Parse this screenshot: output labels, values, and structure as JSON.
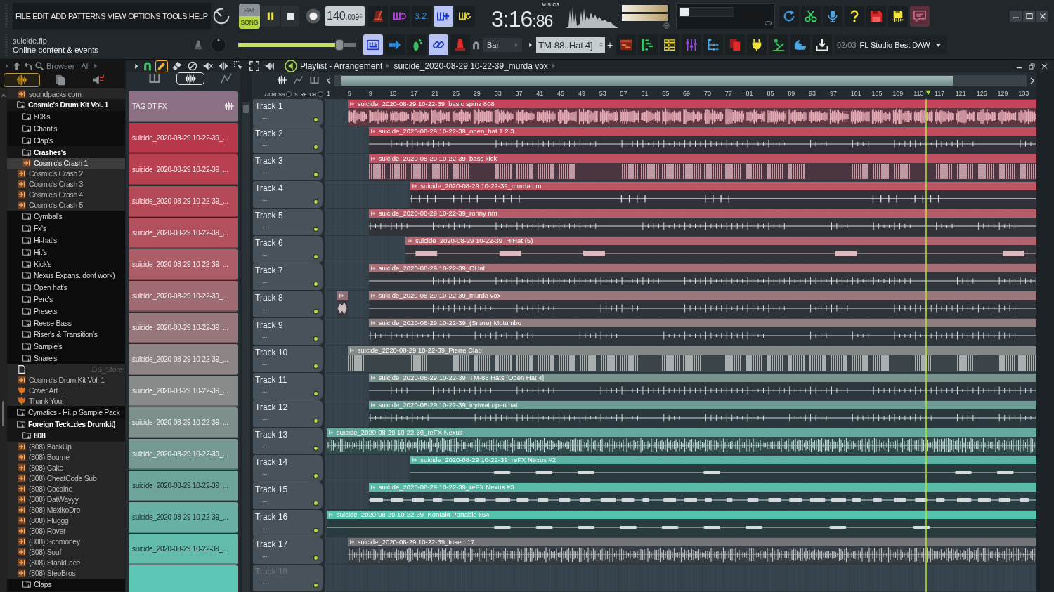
{
  "menu": [
    "FILE",
    "EDIT",
    "ADD",
    "PATTERNS",
    "VIEW",
    "OPTIONS",
    "TOOLS",
    "HELP"
  ],
  "transport": {
    "modes": [
      {
        "label": "PAT",
        "selected": false
      },
      {
        "label": "SONG",
        "selected": true
      }
    ],
    "playing": true,
    "recording": false,
    "tempo": "140",
    "tempo_fraction": ".009"
  },
  "record_options": [
    {
      "on": false
    },
    {
      "on": false
    },
    {
      "label": "3.2.",
      "on": false
    },
    {
      "on": true
    },
    {
      "on": false
    }
  ],
  "clock": {
    "time": "3:16",
    "centiseconds": ":86",
    "format": "M:S:CS"
  },
  "meters": [
    {
      "level": 0.96
    },
    {
      "level": 0.96
    }
  ],
  "performance": {
    "level": 0.16
  },
  "project": {
    "file": "suicide.flp",
    "hint": "Online content & events"
  },
  "master_volume": {
    "level": 0.86
  },
  "playback_options": [
    {
      "on": true
    },
    {
      "on": false
    },
    {
      "on": false
    },
    {
      "on": true
    },
    {
      "on": false
    }
  ],
  "snap": "Bar",
  "pattern": {
    "value": "TM-88..Hat 4]",
    "add": "+"
  },
  "news": {
    "counter": "02/03",
    "title": "FL Studio Best DAW"
  },
  "browser": {
    "title": "Browser - All",
    "tabs": [
      {
        "selected": true
      },
      {
        "selected": false
      },
      {
        "selected": false
      }
    ],
    "items": [
      {
        "kind": "sample",
        "name": "soundpacks.com",
        "selected": false
      },
      {
        "kind": "folder",
        "name": "Cosmic's Drum Kit Vol. 1",
        "expanded": true,
        "selected": false,
        "children": [
          {
            "kind": "folder",
            "name": "808's",
            "expanded": false,
            "selected": false
          },
          {
            "kind": "folder",
            "name": "Chant's",
            "expanded": false,
            "selected": false
          },
          {
            "kind": "folder",
            "name": "Clap's",
            "expanded": false,
            "selected": false
          },
          {
            "kind": "folder",
            "name": "Crashes's",
            "expanded": true,
            "selected": false,
            "children": [
              {
                "kind": "sample",
                "name": "Cosmic's Crash 1",
                "selected": true
              },
              {
                "kind": "sample",
                "name": "Cosmic's Crash 2",
                "selected": false
              },
              {
                "kind": "sample",
                "name": "Cosmic's Crash 3",
                "selected": false
              },
              {
                "kind": "sample",
                "name": "Cosmic's Crash 4",
                "selected": false
              },
              {
                "kind": "sample",
                "name": "Cosmic's Crash 5",
                "selected": false
              }
            ]
          },
          {
            "kind": "folder",
            "name": "Cymbal's",
            "expanded": false,
            "selected": false
          },
          {
            "kind": "folder",
            "name": "Fx's",
            "expanded": false,
            "selected": false
          },
          {
            "kind": "folder",
            "name": "Hi-hat's",
            "expanded": false,
            "selected": false
          },
          {
            "kind": "folder",
            "name": "Hit's",
            "expanded": false,
            "selected": false
          },
          {
            "kind": "folder",
            "name": "Kick's",
            "expanded": false,
            "selected": false
          },
          {
            "kind": "folder",
            "name": "Nexus Expans..dont work)",
            "expanded": false,
            "selected": false
          },
          {
            "kind": "folder",
            "name": "Open hat's",
            "expanded": false,
            "selected": false
          },
          {
            "kind": "folder",
            "name": "Perc's",
            "expanded": false,
            "selected": false
          },
          {
            "kind": "folder",
            "name": "Presets",
            "expanded": false,
            "selected": false
          },
          {
            "kind": "folder",
            "name": "Reese Bass",
            "expanded": false,
            "selected": false
          },
          {
            "kind": "folder",
            "name": "Riser's & Transition's",
            "expanded": false,
            "selected": false
          },
          {
            "kind": "folder",
            "name": "Sample's",
            "expanded": false,
            "selected": false
          },
          {
            "kind": "folder",
            "name": "Snare's",
            "expanded": false,
            "selected": false
          },
          {
            "kind": "document",
            "name": ".DS_Store",
            "selected": false
          },
          {
            "kind": "sample",
            "name": "Cosmic's Drum Kit Vol. 1",
            "selected": false
          },
          {
            "kind": "image",
            "name": "Cover Art",
            "selected": false
          },
          {
            "kind": "image",
            "name": "Thank You!",
            "selected": false
          }
        ]
      },
      {
        "kind": "folder",
        "name": "Cymatics - Hi..p Sample Pack",
        "expanded": false,
        "selected": false
      },
      {
        "kind": "folder",
        "name": "Foreign Teck..des Drumkit)",
        "expanded": true,
        "selected": false,
        "children": [
          {
            "kind": "folder",
            "name": "808",
            "expanded": true,
            "selected": false,
            "children": [
              {
                "kind": "sample",
                "name": "(808) BackUp",
                "selected": false
              },
              {
                "kind": "sample",
                "name": "(808) Bourne",
                "selected": false
              },
              {
                "kind": "sample",
                "name": "(808) Cake",
                "selected": false
              },
              {
                "kind": "sample",
                "name": "(808) CheatCode Sub",
                "selected": false
              },
              {
                "kind": "sample",
                "name": "(808) Cocaine",
                "selected": false
              },
              {
                "kind": "sample",
                "name": "(808) DatWayyy",
                "selected": false
              },
              {
                "kind": "sample",
                "name": "(808) MexikoDro",
                "selected": false
              },
              {
                "kind": "sample",
                "name": "(808) Pluggg",
                "selected": false
              },
              {
                "kind": "sample",
                "name": "(808) Rover",
                "selected": false
              },
              {
                "kind": "sample",
                "name": "(808) Schmoney",
                "selected": false
              },
              {
                "kind": "sample",
                "name": "(808) Souf",
                "selected": false
              },
              {
                "kind": "sample",
                "name": "(808) StankFace",
                "selected": false
              },
              {
                "kind": "sample",
                "name": "(808) StepBros",
                "selected": false
              }
            ]
          },
          {
            "kind": "folder",
            "name": "Claps",
            "expanded": false,
            "selected": false
          }
        ]
      }
    ]
  },
  "playlist": {
    "title": "Playlist - Arrangement",
    "current_clip": "suicide_2020-08-29 10-22-39_murda vox",
    "tools": [
      {
        "selected": true
      },
      {
        "selected": false
      },
      {
        "selected": false
      },
      {
        "selected": false
      },
      {
        "selected": false
      },
      {
        "selected": false
      },
      {
        "selected": false
      },
      {
        "selected": false
      }
    ],
    "clip_filters": [
      {
        "selected": false
      },
      {
        "selected": true
      },
      {
        "selected": false
      }
    ],
    "options": [
      {
        "label": "Z-CROSS",
        "checked": false
      },
      {
        "label": "STRETCH",
        "checked": false
      }
    ],
    "ruler": [
      "1",
      "5",
      "9",
      "13",
      "17",
      "21",
      "25",
      "29",
      "33",
      "37",
      "41",
      "45",
      "49",
      "53",
      "57",
      "61",
      "65",
      "69",
      "73",
      "77",
      "81",
      "85",
      "89",
      "93",
      "97",
      "101",
      "105",
      "109",
      "113",
      "117",
      "121",
      "125",
      "129",
      "133"
    ],
    "clip_list": [
      {
        "name": "TAG DT FX",
        "color": "#8b7183"
      },
      {
        "name": "suicide_2020-08-29 10-22-39_...",
        "color": "#b8384c"
      },
      {
        "name": "suicide_2020-08-29 10-22-39_...",
        "color": "#b9404f"
      },
      {
        "name": "suicide_2020-08-29 10-22-39_...",
        "color": "#b44a58"
      },
      {
        "name": "suicide_2020-08-29 10-22-39_...",
        "color": "#b3505d"
      },
      {
        "name": "suicide_2020-08-29 10-22-39_...",
        "color": "#ab5d68"
      },
      {
        "name": "suicide_2020-08-29 10-22-39_...",
        "color": "#a06a72"
      },
      {
        "name": "suicide_2020-08-29 10-22-39_...",
        "color": "#97777b"
      },
      {
        "name": "suicide_2020-08-29 10-22-39_...",
        "color": "#8d8486"
      },
      {
        "name": "suicide_2020-08-29 10-22-39_...",
        "color": "#868a89"
      },
      {
        "name": "suicide_2020-08-29 10-22-39_...",
        "color": "#7d908c"
      },
      {
        "name": "suicide_2020-08-29 10-22-39_...",
        "color": "#779993"
      },
      {
        "name": "suicide_2020-08-29 10-22-39_...",
        "color": "#6ea59b"
      },
      {
        "name": "suicide_2020-08-29 10-22-39_...",
        "color": "#69b0a4"
      },
      {
        "name": "suicide_2020-08-29 10-22-39_...",
        "color": "#63bbac"
      },
      {
        "color": "#5ec6b4"
      }
    ],
    "tracks": [
      {
        "name": "Track 1",
        "detail": "...",
        "dimmed": false,
        "clips": [
          {
            "name": "suicide_2020-08-29 10-22-39_basic spinz 808",
            "color": "#c4455b",
            "kind": "dense"
          }
        ]
      },
      {
        "name": "Track 2",
        "detail": "...",
        "dimmed": false,
        "clips": [
          {
            "name": "suicide_2020-08-29 10-22-39_open_hat 1 2 3",
            "color": "#c24b5e",
            "kind": "ticks"
          }
        ]
      },
      {
        "name": "Track 3",
        "detail": "...",
        "dimmed": false,
        "clips": [
          {
            "name": "suicide_2020-08-29 10-22-39_bass kick",
            "color": "#bf5062",
            "kind": "bars"
          }
        ]
      },
      {
        "name": "Track 4",
        "detail": "...",
        "dimmed": false,
        "clips": [
          {
            "name": "suicide_2020-08-29 10-22-39_murda rim",
            "color": "#bc5665",
            "kind": "sparse"
          }
        ]
      },
      {
        "name": "Track 5",
        "detail": "...",
        "dimmed": false,
        "clips": [
          {
            "name": "suicide_2020-08-29 10-22-39_ronny rim",
            "color": "#b75d69",
            "kind": "ticks"
          }
        ]
      },
      {
        "name": "Track 6",
        "detail": "...",
        "dimmed": false,
        "clips": [
          {
            "name": "suicide_2020-08-29 10-22-39_HiHat (5)",
            "color": "#b0656f",
            "kind": "blocks"
          }
        ]
      },
      {
        "name": "Track 7",
        "detail": "...",
        "dimmed": false,
        "clips": [
          {
            "name": "suicide_2020-08-29 10-22-39_OHat",
            "color": "#a66e75",
            "kind": "ticks"
          }
        ]
      },
      {
        "name": "Track 8",
        "detail": "...",
        "dimmed": false,
        "clips": [
          {
            "color": "#8f6f78",
            "kind": "blob"
          },
          {
            "name": "suicide_2020-08-29 10-22-39_murda vox",
            "color": "#9b767a",
            "kind": "ticks"
          }
        ]
      },
      {
        "name": "Track 9",
        "detail": "...",
        "dimmed": false,
        "clips": [
          {
            "name": "suicide_2020-08-29 10-22-39_(Snare) Motumbo",
            "color": "#8f7d80",
            "kind": "ticks"
          }
        ]
      },
      {
        "name": "Track 10",
        "detail": "...",
        "dimmed": false,
        "clips": [
          {
            "name": "suicide_2020-08-29 10-22-39_Pierre Clap",
            "color": "#838785",
            "kind": "bars"
          }
        ]
      },
      {
        "name": "Track 11",
        "detail": "...",
        "dimmed": false,
        "clips": [
          {
            "name": "suicide_2020-08-29 10-22-39_TM-88 Hats [Open Hat 4]",
            "color": "#78918c",
            "kind": "ticks"
          }
        ]
      },
      {
        "name": "Track 12",
        "detail": "...",
        "dimmed": false,
        "clips": [
          {
            "name": "suicide_2020-08-29 10-22-39_icytwat open hat",
            "color": "#6e9b93",
            "kind": "ticks"
          }
        ]
      },
      {
        "name": "Track 13",
        "detail": "...",
        "dimmed": false,
        "clips": [
          {
            "name": "suicide_2020-08-29 10-22-39_reFX Nexus",
            "color": "#63a99c",
            "kind": "wave"
          }
        ]
      },
      {
        "name": "Track 14",
        "detail": "...",
        "dimmed": false,
        "clips": [
          {
            "name": "suicide_2020-08-29 10-22-39_reFX Nexus #2",
            "color": "#5db3a3",
            "kind": "line"
          }
        ]
      },
      {
        "name": "Track 15",
        "detail": "...",
        "dimmed": false,
        "clips": [
          {
            "name": "suicide_2020-08-29 10-22-39_reFX Nexus #3",
            "color": "#58bba8",
            "kind": "blobs"
          }
        ]
      },
      {
        "name": "Track 16",
        "detail": "...",
        "dimmed": false,
        "clips": [
          {
            "name": "suicide_2020-08-29 10-22-39_Kontakt Portable x64",
            "color": "#55c3ad",
            "kind": "line"
          }
        ]
      },
      {
        "name": "Track 17",
        "detail": "...",
        "dimmed": false,
        "clips": [
          {
            "name": "suicide_2020-08-29 10-22-39_Insert 17",
            "color": "#737478",
            "kind": "wave"
          }
        ]
      },
      {
        "name": "Track 18",
        "detail": "...",
        "dimmed": true
      }
    ]
  }
}
